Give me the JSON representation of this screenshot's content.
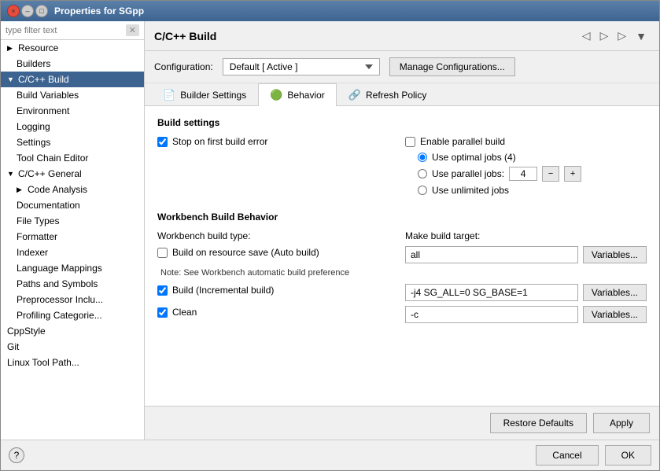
{
  "dialog": {
    "title": "Properties for SGpp"
  },
  "title_bar": {
    "close_label": "×",
    "minimize_label": "–",
    "maximize_label": "□"
  },
  "filter": {
    "placeholder": "type filter text"
  },
  "sidebar": {
    "items": [
      {
        "id": "resource",
        "label": "Resource",
        "level": 0,
        "expandable": true
      },
      {
        "id": "builders",
        "label": "Builders",
        "level": 1,
        "expandable": false
      },
      {
        "id": "cpp-build",
        "label": "C/C++ Build",
        "level": 0,
        "expandable": true,
        "selected": true
      },
      {
        "id": "build-variables",
        "label": "Build Variables",
        "level": 1,
        "expandable": false
      },
      {
        "id": "environment",
        "label": "Environment",
        "level": 1,
        "expandable": false
      },
      {
        "id": "logging",
        "label": "Logging",
        "level": 1,
        "expandable": false
      },
      {
        "id": "settings",
        "label": "Settings",
        "level": 1,
        "expandable": false
      },
      {
        "id": "tool-chain-editor",
        "label": "Tool Chain Editor",
        "level": 1,
        "expandable": false
      },
      {
        "id": "cpp-general",
        "label": "C/C++ General",
        "level": 0,
        "expandable": true
      },
      {
        "id": "code-analysis",
        "label": "Code Analysis",
        "level": 1,
        "expandable": true
      },
      {
        "id": "documentation",
        "label": "Documentation",
        "level": 1,
        "expandable": false
      },
      {
        "id": "file-types",
        "label": "File Types",
        "level": 1,
        "expandable": false
      },
      {
        "id": "formatter",
        "label": "Formatter",
        "level": 1,
        "expandable": false
      },
      {
        "id": "indexer",
        "label": "Indexer",
        "level": 1,
        "expandable": false
      },
      {
        "id": "language-mappings",
        "label": "Language Mappings",
        "level": 1,
        "expandable": false
      },
      {
        "id": "paths-and-symbols",
        "label": "Paths and Symbols",
        "level": 1,
        "expandable": false
      },
      {
        "id": "preprocessor-includes",
        "label": "Preprocessor Inclu...",
        "level": 1,
        "expandable": false
      },
      {
        "id": "profiling-categories",
        "label": "Profiling Categorie...",
        "level": 1,
        "expandable": false
      },
      {
        "id": "cppstyle",
        "label": "CppStyle",
        "level": 0,
        "expandable": false
      },
      {
        "id": "git",
        "label": "Git",
        "level": 0,
        "expandable": false
      },
      {
        "id": "linux-tool-path",
        "label": "Linux Tool Path...",
        "level": 0,
        "expandable": false
      }
    ]
  },
  "panel": {
    "title": "C/C++ Build",
    "config_label": "Configuration:",
    "config_value": "Default [ Active ]",
    "manage_btn": "Manage Configurations...",
    "tabs": [
      {
        "id": "builder-settings",
        "label": "Builder Settings",
        "icon": "📄"
      },
      {
        "id": "behavior",
        "label": "Behavior",
        "icon": "🟢",
        "active": true
      },
      {
        "id": "refresh-policy",
        "label": "Refresh Policy",
        "icon": "🔗"
      }
    ]
  },
  "build_settings": {
    "title": "Build settings",
    "stop_on_error_checked": true,
    "stop_on_error_label": "Stop on first build error",
    "enable_parallel_checked": false,
    "enable_parallel_label": "Enable parallel build",
    "use_optimal_checked": true,
    "use_optimal_label": "Use optimal jobs (4)",
    "use_parallel_checked": false,
    "use_parallel_label": "Use parallel jobs:",
    "parallel_jobs_value": "4",
    "use_unlimited_checked": false,
    "use_unlimited_label": "Use unlimited jobs"
  },
  "workbench": {
    "title": "Workbench Build Behavior",
    "type_label": "Workbench build type:",
    "target_label": "Make build target:",
    "auto_build_checked": false,
    "auto_build_label": "Build on resource save (Auto build)",
    "auto_build_target": "all",
    "note": "Note: See Workbench automatic build preference",
    "incremental_checked": true,
    "incremental_label": "Build (Incremental build)",
    "incremental_target": "-j4 SG_ALL=0 SG_BASE=1",
    "clean_checked": true,
    "clean_label": "Clean",
    "clean_target": "-c",
    "variables_btn": "Variables..."
  },
  "buttons": {
    "restore_defaults": "Restore Defaults",
    "apply": "Apply",
    "cancel": "Cancel",
    "ok": "OK",
    "help": "?"
  }
}
